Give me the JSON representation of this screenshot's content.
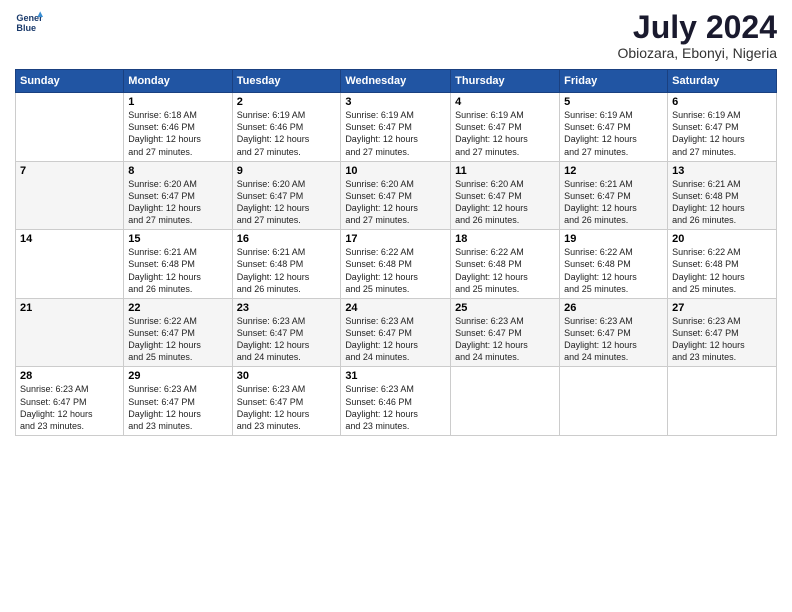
{
  "header": {
    "logo": {
      "line1": "General",
      "line2": "Blue"
    },
    "title": "July 2024",
    "subtitle": "Obiozara, Ebonyi, Nigeria"
  },
  "columns": [
    "Sunday",
    "Monday",
    "Tuesday",
    "Wednesday",
    "Thursday",
    "Friday",
    "Saturday"
  ],
  "weeks": [
    [
      {
        "day": "",
        "info": ""
      },
      {
        "day": "1",
        "info": "Sunrise: 6:18 AM\nSunset: 6:46 PM\nDaylight: 12 hours\nand 27 minutes."
      },
      {
        "day": "2",
        "info": "Sunrise: 6:19 AM\nSunset: 6:46 PM\nDaylight: 12 hours\nand 27 minutes."
      },
      {
        "day": "3",
        "info": "Sunrise: 6:19 AM\nSunset: 6:47 PM\nDaylight: 12 hours\nand 27 minutes."
      },
      {
        "day": "4",
        "info": "Sunrise: 6:19 AM\nSunset: 6:47 PM\nDaylight: 12 hours\nand 27 minutes."
      },
      {
        "day": "5",
        "info": "Sunrise: 6:19 AM\nSunset: 6:47 PM\nDaylight: 12 hours\nand 27 minutes."
      },
      {
        "day": "6",
        "info": "Sunrise: 6:19 AM\nSunset: 6:47 PM\nDaylight: 12 hours\nand 27 minutes."
      }
    ],
    [
      {
        "day": "7",
        "info": ""
      },
      {
        "day": "8",
        "info": "Sunrise: 6:20 AM\nSunset: 6:47 PM\nDaylight: 12 hours\nand 27 minutes."
      },
      {
        "day": "9",
        "info": "Sunrise: 6:20 AM\nSunset: 6:47 PM\nDaylight: 12 hours\nand 27 minutes."
      },
      {
        "day": "10",
        "info": "Sunrise: 6:20 AM\nSunset: 6:47 PM\nDaylight: 12 hours\nand 27 minutes."
      },
      {
        "day": "11",
        "info": "Sunrise: 6:20 AM\nSunset: 6:47 PM\nDaylight: 12 hours\nand 26 minutes."
      },
      {
        "day": "12",
        "info": "Sunrise: 6:21 AM\nSunset: 6:47 PM\nDaylight: 12 hours\nand 26 minutes."
      },
      {
        "day": "13",
        "info": "Sunrise: 6:21 AM\nSunset: 6:48 PM\nDaylight: 12 hours\nand 26 minutes."
      }
    ],
    [
      {
        "day": "14",
        "info": ""
      },
      {
        "day": "15",
        "info": "Sunrise: 6:21 AM\nSunset: 6:48 PM\nDaylight: 12 hours\nand 26 minutes."
      },
      {
        "day": "16",
        "info": "Sunrise: 6:21 AM\nSunset: 6:48 PM\nDaylight: 12 hours\nand 26 minutes."
      },
      {
        "day": "17",
        "info": "Sunrise: 6:22 AM\nSunset: 6:48 PM\nDaylight: 12 hours\nand 25 minutes."
      },
      {
        "day": "18",
        "info": "Sunrise: 6:22 AM\nSunset: 6:48 PM\nDaylight: 12 hours\nand 25 minutes."
      },
      {
        "day": "19",
        "info": "Sunrise: 6:22 AM\nSunset: 6:48 PM\nDaylight: 12 hours\nand 25 minutes."
      },
      {
        "day": "20",
        "info": "Sunrise: 6:22 AM\nSunset: 6:48 PM\nDaylight: 12 hours\nand 25 minutes."
      }
    ],
    [
      {
        "day": "21",
        "info": ""
      },
      {
        "day": "22",
        "info": "Sunrise: 6:22 AM\nSunset: 6:47 PM\nDaylight: 12 hours\nand 25 minutes."
      },
      {
        "day": "23",
        "info": "Sunrise: 6:23 AM\nSunset: 6:47 PM\nDaylight: 12 hours\nand 24 minutes."
      },
      {
        "day": "24",
        "info": "Sunrise: 6:23 AM\nSunset: 6:47 PM\nDaylight: 12 hours\nand 24 minutes."
      },
      {
        "day": "25",
        "info": "Sunrise: 6:23 AM\nSunset: 6:47 PM\nDaylight: 12 hours\nand 24 minutes."
      },
      {
        "day": "26",
        "info": "Sunrise: 6:23 AM\nSunset: 6:47 PM\nDaylight: 12 hours\nand 24 minutes."
      },
      {
        "day": "27",
        "info": "Sunrise: 6:23 AM\nSunset: 6:47 PM\nDaylight: 12 hours\nand 23 minutes."
      }
    ],
    [
      {
        "day": "28",
        "info": "Sunrise: 6:23 AM\nSunset: 6:47 PM\nDaylight: 12 hours\nand 23 minutes."
      },
      {
        "day": "29",
        "info": "Sunrise: 6:23 AM\nSunset: 6:47 PM\nDaylight: 12 hours\nand 23 minutes."
      },
      {
        "day": "30",
        "info": "Sunrise: 6:23 AM\nSunset: 6:47 PM\nDaylight: 12 hours\nand 23 minutes."
      },
      {
        "day": "31",
        "info": "Sunrise: 6:23 AM\nSunset: 6:46 PM\nDaylight: 12 hours\nand 23 minutes."
      },
      {
        "day": "",
        "info": ""
      },
      {
        "day": "",
        "info": ""
      },
      {
        "day": "",
        "info": ""
      }
    ]
  ]
}
